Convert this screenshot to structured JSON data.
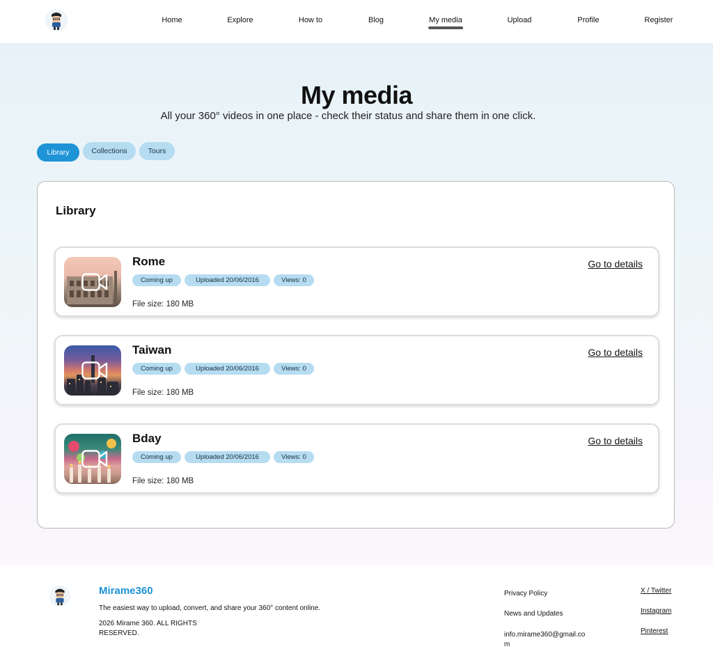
{
  "nav": {
    "items": [
      {
        "label": "Home"
      },
      {
        "label": "Explore"
      },
      {
        "label": "How to"
      },
      {
        "label": "Blog"
      },
      {
        "label": "My media"
      },
      {
        "label": "Upload"
      },
      {
        "label": "Profile"
      },
      {
        "label": "Register"
      }
    ],
    "active": "My media"
  },
  "hero": {
    "title": "My media",
    "subtitle": "All your 360° videos in one place - check their status and share them in one click."
  },
  "tabs": [
    {
      "label": "Library",
      "active": true
    },
    {
      "label": "Collections",
      "active": false
    },
    {
      "label": "Tours",
      "active": false
    }
  ],
  "library": {
    "title": "Library",
    "items": [
      {
        "title": "Rome",
        "status": "Coming up",
        "uploaded": "Uploaded 20/06/2016",
        "views": "Views: 0",
        "file_size": "File size: 180 MB",
        "details": "Go to details"
      },
      {
        "title": "Taiwan",
        "status": "Coming up",
        "uploaded": "Uploaded 20/06/2016",
        "views": "Views: 0",
        "file_size": "File size: 180 MB",
        "details": "Go to details"
      },
      {
        "title": "Bday",
        "status": "Coming up",
        "uploaded": "Uploaded 20/06/2016",
        "views": "Views: 0",
        "file_size": "File size: 180 MB",
        "details": "Go to details"
      }
    ]
  },
  "footer": {
    "brand": "Mirame360",
    "tagline": "The easiest way to upload, convert, and share your 360° content online.",
    "copyright": "2026 Mirame 360. ALL RIGHTS RESERVED.",
    "links": [
      "Privacy Policy",
      "News and Updates",
      "info.mirame360@gmail.com"
    ],
    "social": [
      "X / Twitter",
      "Instagram",
      "Pinterest"
    ]
  },
  "colors": {
    "accent": "#1e93d6",
    "badge": "#b6dcf1",
    "hero_top": "#e7f2f8",
    "hero_bottom": "#fbf7fc"
  },
  "icons": {
    "logo": "avatar-logo-icon",
    "thumbnail_overlay": "video-camera-icon"
  }
}
